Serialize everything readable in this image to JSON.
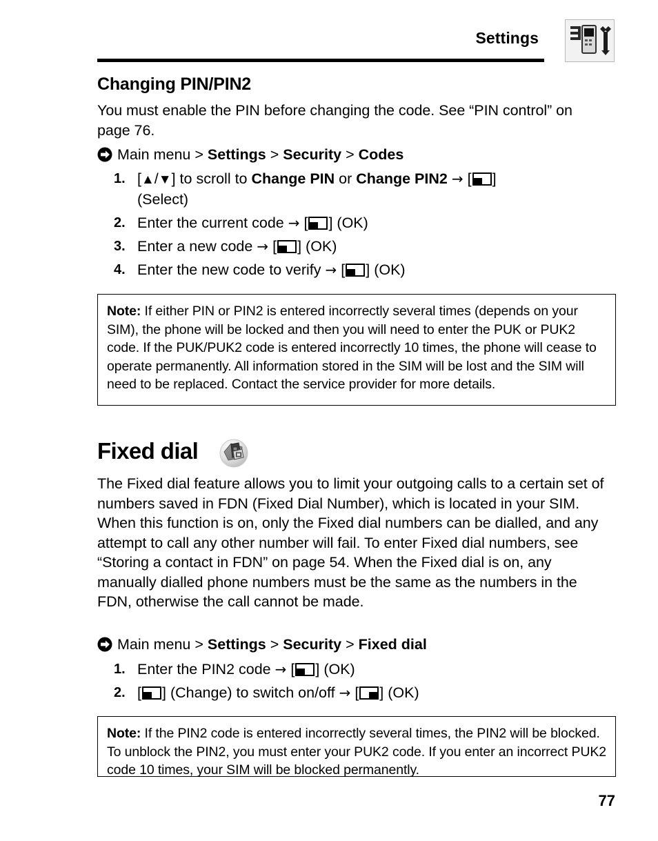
{
  "header": {
    "title": "Settings",
    "icon": "settings-phone-wrench-icon"
  },
  "section1": {
    "heading": "Changing PIN/PIN2",
    "intro": "You must enable the PIN before changing the code. See “PIN control” on page 76.",
    "nav": {
      "icon": "nav-arrow-icon",
      "prefix": "Main menu",
      "sep": ">",
      "crumb1": "Settings",
      "crumb2": "Security",
      "crumb3": "Codes"
    },
    "steps": [
      {
        "num": "1.",
        "pre": "[",
        "up": "▲",
        "slash": "/",
        "down": "▼",
        "post": "] to scroll to ",
        "bold1": "Change PIN",
        "mid": " or ",
        "bold2": "Change PIN2",
        "arrow": "→",
        "key": "soft-key-select-left",
        "label": "(Select)"
      },
      {
        "num": "2.",
        "text": "Enter the current code",
        "arrow": "→",
        "key": "soft-key-ok-left",
        "label": "(OK)"
      },
      {
        "num": "3.",
        "text": "Enter a new code",
        "arrow": "→",
        "key": "soft-key-ok-left",
        "label": "(OK)"
      },
      {
        "num": "4.",
        "text": "Enter the new code to verify",
        "arrow": "→",
        "key": "soft-key-ok-left",
        "label": "(OK)"
      }
    ],
    "note": {
      "label": "Note:",
      "text": " If either PIN or PIN2 is entered incorrectly several times (depends on your SIM), the phone will be locked and then you will need to enter the PUK or PUK2 code. If the PUK/PUK2 code is entered incorrectly 10 times, the phone will cease to operate permanently. All information stored in the SIM will be lost and the SIM will need to be replaced. Contact the service provider for more details."
    }
  },
  "section2": {
    "heading": "Fixed dial",
    "icon": "fixed-dial-sim-badge-icon",
    "body": "The Fixed dial feature allows you to limit your outgoing calls to a certain set of numbers saved in FDN (Fixed Dial Number), which is located in your SIM. When this function is on, only the Fixed dial numbers can be dialled, and any attempt to call any other number will fail. To enter Fixed dial numbers, see “Storing a contact in FDN” on page 54. When the Fixed dial is on, any manually dialled phone numbers must be the same as the numbers in the FDN, otherwise the call cannot be made.",
    "nav": {
      "icon": "nav-arrow-icon",
      "prefix": "Main menu",
      "sep": ">",
      "crumb1": "Settings",
      "crumb2": "Security",
      "crumb3": "Fixed dial"
    },
    "steps": [
      {
        "num": "1.",
        "text": "Enter the PIN2 code",
        "arrow": "→",
        "key": "soft-key-ok-left",
        "label": "(OK)"
      },
      {
        "num": "2.",
        "key1": "soft-key-change-left",
        "label1": "(Change) to switch on/off",
        "arrow": "→",
        "key2": "soft-key-ok-right",
        "label2": "(OK)"
      }
    ],
    "note": {
      "label": "Note:",
      "text": " If the PIN2 code is entered incorrectly several times, the PIN2 will be blocked. To unblock the PIN2, you must enter your PUK2 code. If you enter an incorrect PUK2 code 10 times, your SIM will be blocked permanently."
    }
  },
  "footer": {
    "page_number": "77"
  },
  "colors": {
    "text": "#000000",
    "background": "#ffffff",
    "icon_frame": "#b9b9b9",
    "icon_fill": "#f0f0f0",
    "badge_gray": "#9a9a9a"
  }
}
